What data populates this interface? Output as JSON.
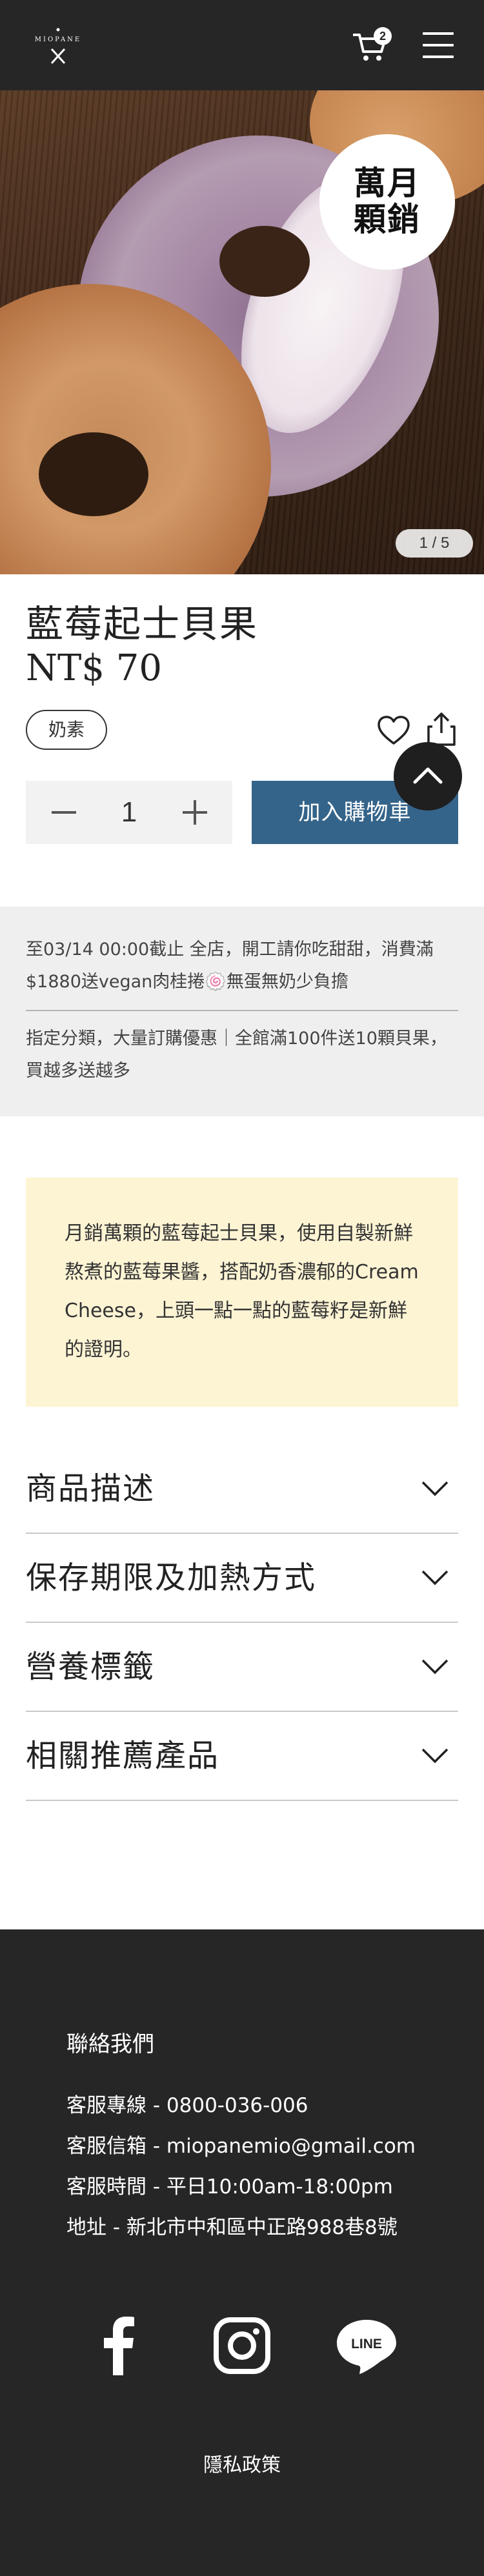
{
  "header": {
    "logo_text": "MIOPANE",
    "cart_count": "2"
  },
  "hero": {
    "stamp_line1": "萬月",
    "stamp_line2": "顆銷",
    "pager": "1 / 5"
  },
  "product": {
    "name": "藍莓起士貝果",
    "price": "NT$ 70",
    "tag": "奶素",
    "quantity": "1",
    "add_to_cart": "加入購物車"
  },
  "promo": {
    "line1": "至03/14 00:00截止 全店，開工請你吃甜甜，消費滿$1880送vegan肉桂捲🍥無蛋無奶少負擔",
    "line2": "指定分類，大量訂購優惠｜全館滿100件送10顆貝果，買越多送越多"
  },
  "description": "月銷萬顆的藍莓起士貝果，使用自製新鮮熬煮的藍莓果醬，搭配奶香濃郁的Cream Cheese，上頭一點一點的藍莓籽是新鮮的證明。",
  "accordions": [
    {
      "label": "商品描述"
    },
    {
      "label": "保存期限及加熱方式"
    },
    {
      "label": "營養標籤"
    },
    {
      "label": "相關推薦產品"
    }
  ],
  "footer": {
    "title": "聯絡我們",
    "phone": "客服專線 - 0800-036-006",
    "email": "客服信箱 - miopanemio@gmail.com",
    "hours": "客服時間 - 平日10:00am-18:00pm",
    "address": "地址 - 新北市中和區中正路988巷8號",
    "line_logo": "LINE",
    "privacy": "隱私政策"
  },
  "colors": {
    "header_bg": "#262626",
    "accent_blue": "#35648a",
    "desc_bg": "#fdf4d4",
    "promo_bg": "#efefef"
  },
  "icons": [
    "logo-crossed-utensils-icon",
    "cart-icon",
    "menu-icon",
    "heart-icon",
    "share-icon",
    "chevron-up-icon",
    "minus-icon",
    "plus-icon",
    "chevron-down-icon",
    "facebook-icon",
    "instagram-icon",
    "line-icon"
  ]
}
